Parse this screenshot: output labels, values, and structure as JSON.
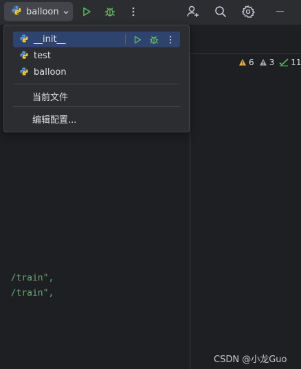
{
  "toolbar": {
    "run_config_label": "balloon",
    "icons": [
      "python-icon",
      "chevron-down-icon",
      "run-icon",
      "debug-icon",
      "more-vertical-icon",
      "add-user-icon",
      "search-icon",
      "settings-icon",
      "minimize-icon"
    ]
  },
  "dropdown": {
    "items": [
      {
        "label": "__init__"
      },
      {
        "label": "test"
      },
      {
        "label": "balloon"
      }
    ],
    "current_file": "当前文件",
    "edit_config": "编辑配置..."
  },
  "inspections": {
    "warnings": "6",
    "weak_warnings": "3",
    "typos": "11"
  },
  "code": {
    "line1": "/train\",",
    "line2": "/train\","
  },
  "watermark": "CSDN @小龙Guo",
  "colors": {
    "run_green": "#5fb865",
    "warning_yellow": "#e8b14a",
    "selection_blue": "#2e436e",
    "string_green": "#6aab73"
  }
}
